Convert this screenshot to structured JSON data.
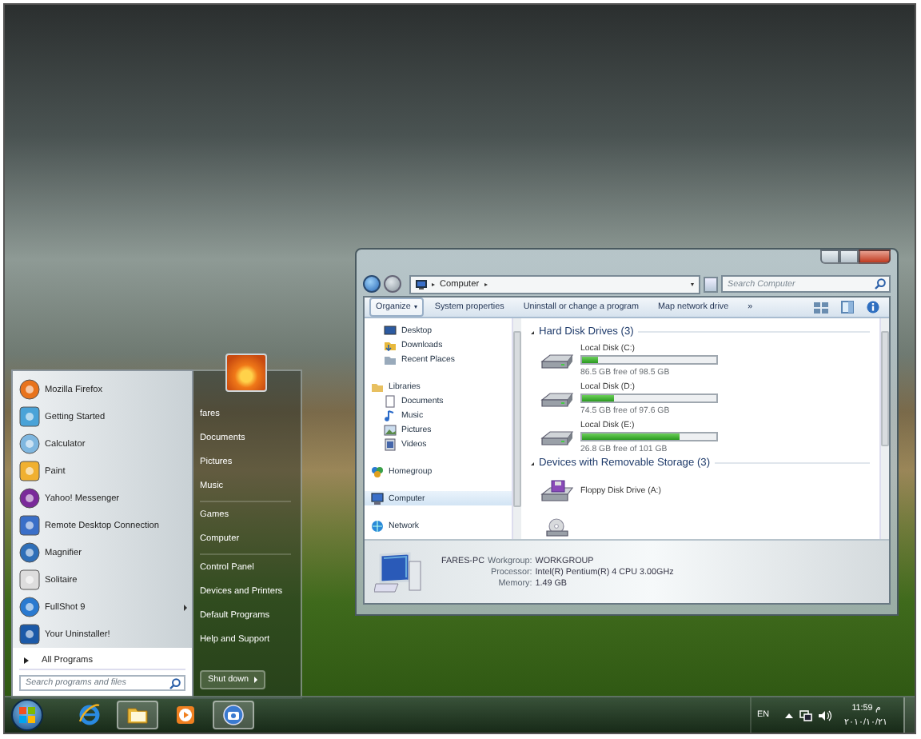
{
  "start_menu": {
    "programs": [
      {
        "label": "Mozilla Firefox",
        "submenu": false
      },
      {
        "label": "Getting Started",
        "submenu": false
      },
      {
        "label": "Calculator",
        "submenu": false
      },
      {
        "label": "Paint",
        "submenu": false
      },
      {
        "label": "Yahoo! Messenger",
        "submenu": false
      },
      {
        "label": "Remote Desktop Connection",
        "submenu": false
      },
      {
        "label": "Magnifier",
        "submenu": false
      },
      {
        "label": "Solitaire",
        "submenu": false
      },
      {
        "label": "FullShot 9",
        "submenu": true
      },
      {
        "label": "Your Uninstaller!",
        "submenu": false
      }
    ],
    "all_programs": "All Programs",
    "search": {
      "placeholder": "Search programs and files"
    },
    "place_groups": [
      {
        "items": [
          "fares",
          "Documents",
          "Pictures",
          "Music"
        ]
      },
      {
        "items": [
          "Games",
          "Computer"
        ]
      },
      {
        "items": [
          "Control Panel",
          "Devices and Printers",
          "Default Programs",
          "Help and Support"
        ]
      }
    ],
    "shutdown": "Shut down"
  },
  "explorer": {
    "address": [
      "Computer"
    ],
    "search": {
      "placeholder": "Search Computer"
    },
    "toolbar": [
      {
        "label": "Organize",
        "dropdown": true
      },
      {
        "label": "System properties",
        "dropdown": false
      },
      {
        "label": "Uninstall or change a program",
        "dropdown": false
      },
      {
        "label": "Map network drive",
        "dropdown": false
      },
      {
        "label": "»",
        "dropdown": false
      }
    ],
    "nav": [
      {
        "children": [
          {
            "label": "Desktop",
            "kind": "desktop",
            "selected": false
          },
          {
            "label": "Downloads",
            "kind": "folder",
            "selected": false
          },
          {
            "label": "Recent Places",
            "kind": "recent",
            "selected": false
          }
        ]
      },
      {
        "label": "Libraries",
        "kind": "library",
        "selected": false,
        "children": [
          {
            "label": "Documents",
            "kind": "document",
            "selected": false
          },
          {
            "label": "Music",
            "kind": "music",
            "selected": false
          },
          {
            "label": "Pictures",
            "kind": "picture",
            "selected": false
          },
          {
            "label": "Videos",
            "kind": "video",
            "selected": false
          }
        ]
      },
      {
        "label": "Homegroup",
        "kind": "homegroup",
        "selected": false
      },
      {
        "label": "Computer",
        "kind": "computer",
        "selected": true
      },
      {
        "label": "Network",
        "kind": "network",
        "selected": false
      }
    ],
    "sections": [
      {
        "title": "Hard Disk Drives (3)",
        "devices": [
          {
            "kind": "hard-disk",
            "name": "Local Disk (C:)",
            "level": 0.12,
            "free": "86.5 GB free of 98.5 GB"
          },
          {
            "kind": "hard-disk",
            "name": "Local Disk (D:)",
            "level": 0.24,
            "free": "74.5 GB free of 97.6 GB"
          },
          {
            "kind": "hard-disk",
            "name": "Local Disk (E:)",
            "level": 0.73,
            "free": "26.8 GB free of 101 GB"
          }
        ]
      },
      {
        "title": "Devices with Removable Storage (3)",
        "devices": [
          {
            "kind": "floppy",
            "name": "Floppy Disk Drive (A:)"
          },
          {
            "kind": "optical"
          }
        ]
      }
    ],
    "details": {
      "computer_name": "FARES-PC",
      "rows": [
        {
          "label": "Workgroup:",
          "value": "WORKGROUP"
        },
        {
          "label": "Processor:",
          "value": "Intel(R) Pentium(R) 4 CPU 3.00GHz"
        },
        {
          "label": "Memory:",
          "value": "1.49 GB"
        }
      ]
    }
  },
  "taskbar": {
    "buttons": [
      {
        "kind": "browser",
        "active": false
      },
      {
        "kind": "folder",
        "active": true
      },
      {
        "kind": "media",
        "active": false
      },
      {
        "kind": "camera",
        "active": true
      }
    ],
    "tray": {
      "language": "EN",
      "time": "11:59 م",
      "date": "٢٠١٠/١٠/٢١"
    }
  }
}
